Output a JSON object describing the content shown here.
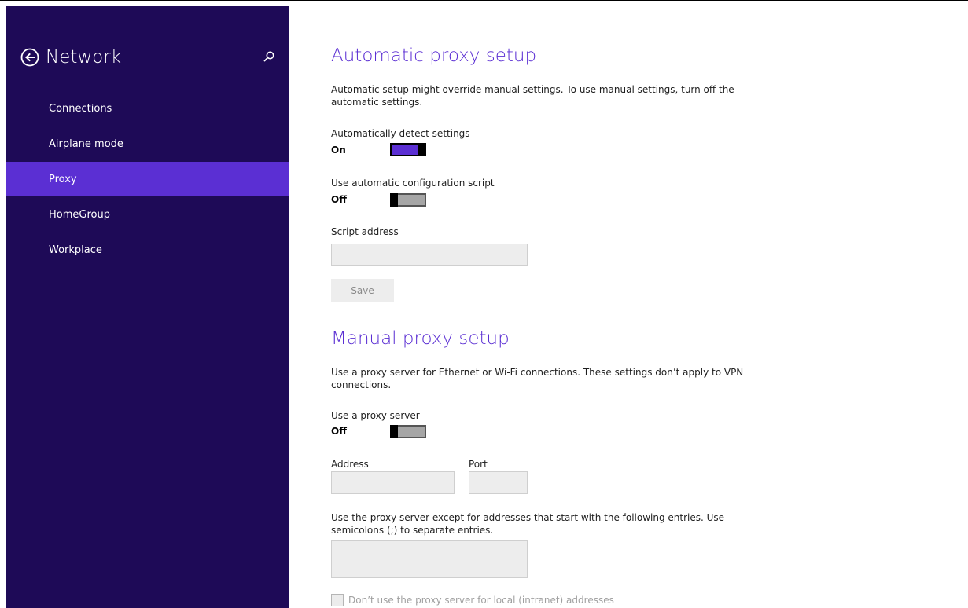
{
  "sidebar": {
    "title": "Network",
    "items": [
      {
        "label": "Connections"
      },
      {
        "label": "Airplane mode"
      },
      {
        "label": "Proxy"
      },
      {
        "label": "HomeGroup"
      },
      {
        "label": "Workplace"
      }
    ],
    "selected_item": "Proxy",
    "background_color": "#1e0a57",
    "selected_color": "#5b2fd3"
  },
  "automatic": {
    "heading": "Automatic proxy setup",
    "description": "Automatic setup might override manual settings. To use manual settings, turn off the automatic settings.",
    "detect_label": "Automatically detect settings",
    "detect_state": "On",
    "script_label": "Use automatic configuration script",
    "script_state": "Off",
    "address_label": "Script address",
    "address_value": "",
    "save_label": "Save"
  },
  "manual": {
    "heading": "Manual proxy setup",
    "description": "Use a proxy server for Ethernet or Wi-Fi connections. These settings don’t apply to VPN connections.",
    "use_proxy_label": "Use a proxy server",
    "use_proxy_state": "Off",
    "address_label": "Address",
    "address_value": "",
    "port_label": "Port",
    "port_value": "",
    "exceptions_description": "Use the proxy server except for addresses that start with the following entries. Use semicolons (;) to separate entries.",
    "exceptions_value": "",
    "local_checkbox_label": "Don’t use the proxy server for local (intranet) addresses",
    "local_checkbox_checked": false
  },
  "accent_color": "#5b2fd3"
}
